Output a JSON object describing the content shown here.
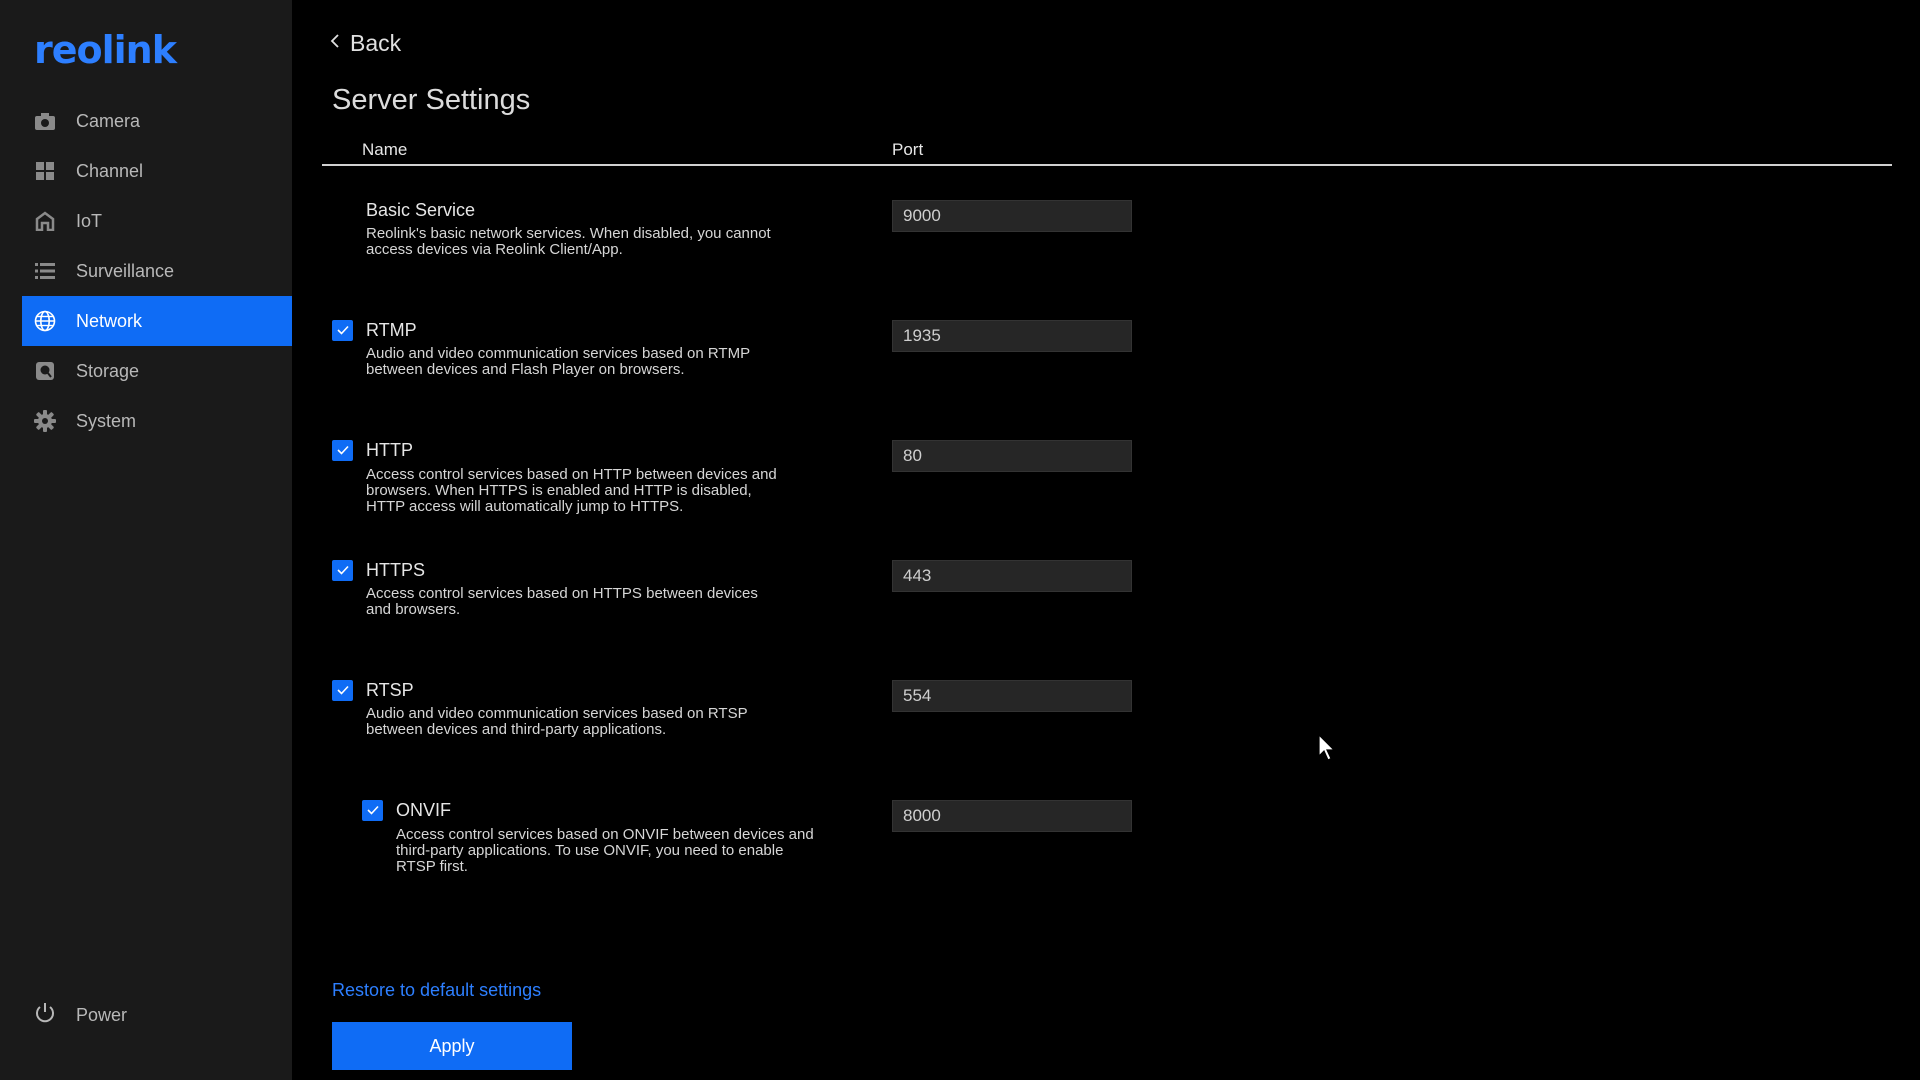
{
  "brand": {
    "logo_text": "reolink",
    "accent": "#0f6cf5",
    "link_color": "#2d7fff"
  },
  "sidebar": {
    "items": [
      {
        "label": "Camera",
        "icon": "camera-icon"
      },
      {
        "label": "Channel",
        "icon": "grid-icon"
      },
      {
        "label": "IoT",
        "icon": "home-icon"
      },
      {
        "label": "Surveillance",
        "icon": "list-icon"
      },
      {
        "label": "Network",
        "icon": "globe-icon",
        "active": true
      },
      {
        "label": "Storage",
        "icon": "storage-icon"
      },
      {
        "label": "System",
        "icon": "gear-icon"
      }
    ],
    "power_label": "Power"
  },
  "header": {
    "back_label": "Back",
    "title": "Server Settings"
  },
  "table": {
    "columns": {
      "name": "Name",
      "port": "Port"
    },
    "services": [
      {
        "name": "Basic Service",
        "description": "Reolink's basic network services. When disabled, you cannot access devices via Reolink Client/App.",
        "port": "9000",
        "checkbox": false
      },
      {
        "name": "RTMP",
        "description": "Audio and video communication services based on RTMP between devices and Flash Player on browsers.",
        "port": "1935",
        "checkbox": true,
        "checked": true
      },
      {
        "name": "HTTP",
        "description": "Access control services based on HTTP between devices and browsers. When HTTPS is enabled and HTTP is disabled, HTTP access will automatically jump to HTTPS.",
        "port": "80",
        "checkbox": true,
        "checked": true
      },
      {
        "name": "HTTPS",
        "description": "Access control services based on HTTPS between devices and browsers.",
        "port": "443",
        "checkbox": true,
        "checked": true
      },
      {
        "name": "RTSP",
        "description": "Audio and video communication services based on RTSP between devices and third-party applications.",
        "port": "554",
        "checkbox": true,
        "checked": true
      },
      {
        "name": "ONVIF",
        "description": "Access control services based on ONVIF between devices and third-party applications. To use ONVIF, you need to enable RTSP first.",
        "port": "8000",
        "checkbox": true,
        "checked": true,
        "indented": true
      }
    ]
  },
  "footer": {
    "restore_label": "Restore to default settings",
    "apply_label": "Apply"
  }
}
